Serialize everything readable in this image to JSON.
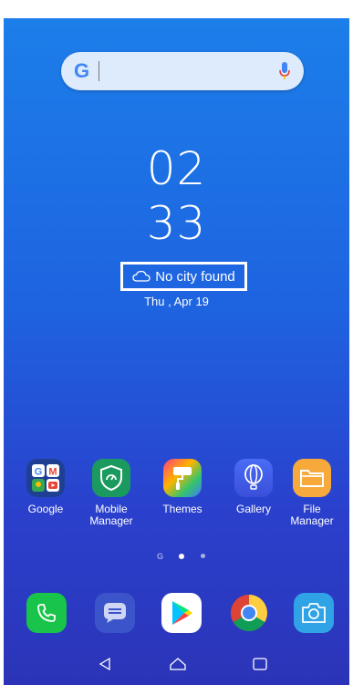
{
  "search": {
    "logo": "G",
    "icon": "mic-icon"
  },
  "clock": {
    "hours": "02",
    "minutes": "33"
  },
  "weather": {
    "icon": "cloud-icon",
    "text": "No city found"
  },
  "date": "Thu , Apr 19",
  "apps": [
    {
      "label": "Google",
      "icon": "google-folder-icon"
    },
    {
      "label": "Mobile Manager",
      "icon": "shield-icon"
    },
    {
      "label": "Themes",
      "icon": "paint-roller-icon"
    },
    {
      "label": "Gallery",
      "icon": "balloon-icon"
    },
    {
      "label": "File Manager",
      "icon": "folder-icon"
    }
  ],
  "page_indicator": {
    "pages": 3,
    "current": 2
  },
  "dock": [
    {
      "icon": "phone-icon"
    },
    {
      "icon": "messages-icon"
    },
    {
      "icon": "play-store-icon"
    },
    {
      "icon": "chrome-icon"
    },
    {
      "icon": "camera-icon"
    }
  ],
  "navigation": [
    "back-icon",
    "home-icon",
    "recents-icon"
  ]
}
